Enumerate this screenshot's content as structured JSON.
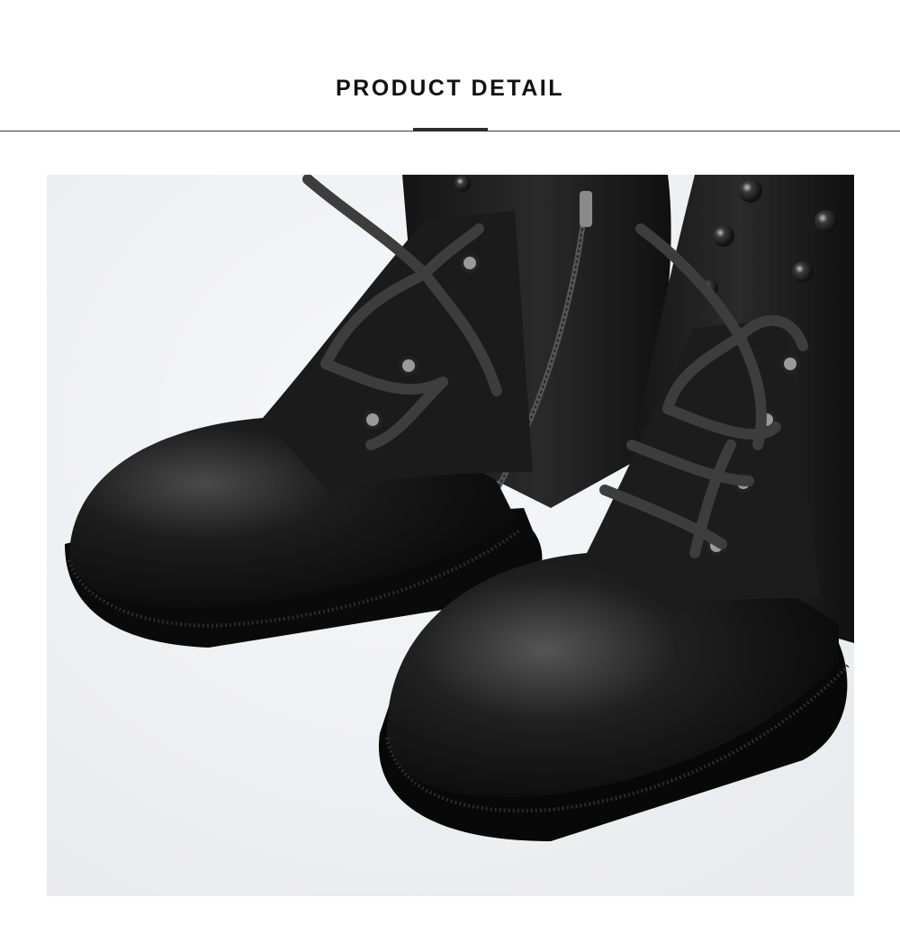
{
  "header": {
    "title": "PRODUCT DETAIL"
  },
  "photo": {
    "subject": "boots-photo",
    "background_color": "#f0f1f3",
    "leather_color": "#161616",
    "sole_color": "#0b0b0b",
    "eyelet_color": "#9a9a9a",
    "lace_color": "#3c3c3c"
  }
}
